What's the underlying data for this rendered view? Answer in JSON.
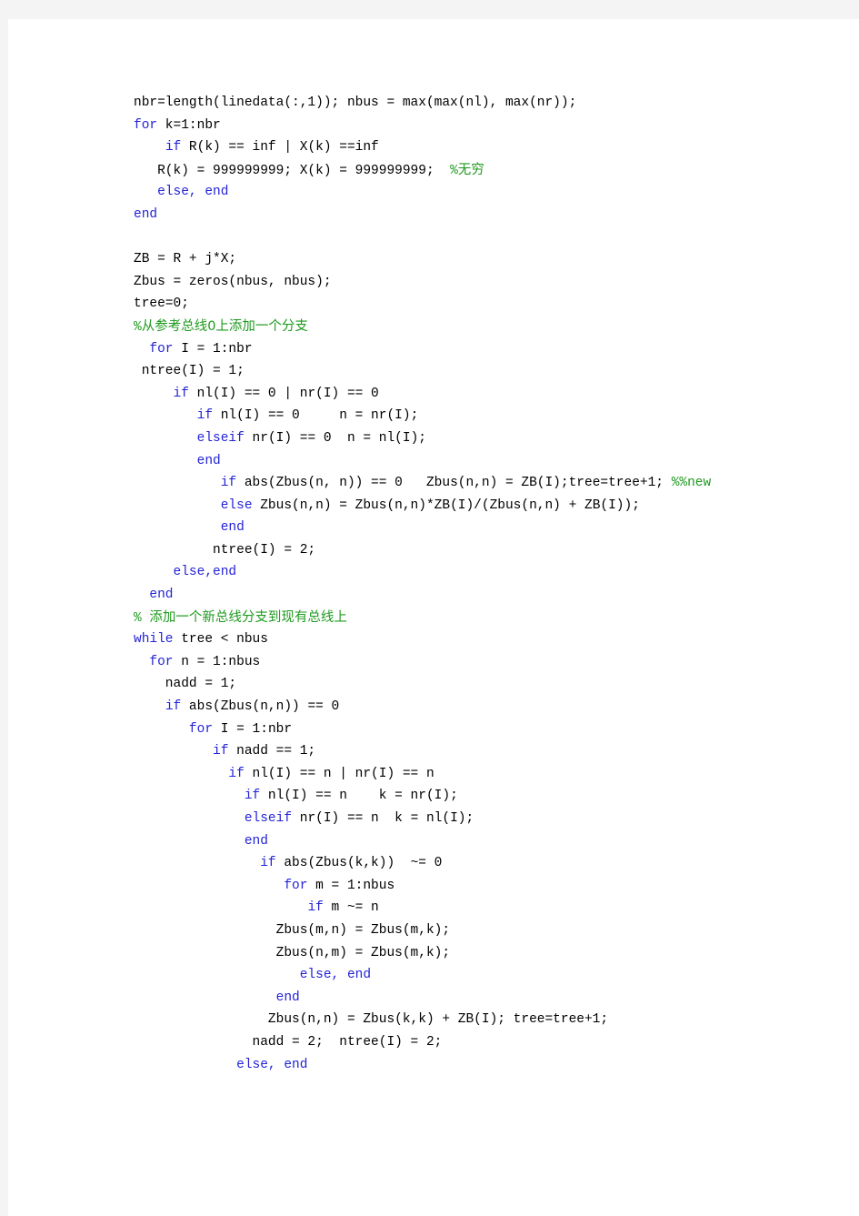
{
  "document": {
    "type": "code-listing",
    "language": "MATLAB",
    "page_background": "#ffffff",
    "canvas_background": "#f4f4f4",
    "colors": {
      "keyword": "#2323d8",
      "comment": "#1f9a1f",
      "plain": "#000000"
    }
  },
  "code": {
    "lines": [
      {
        "id": "line-1",
        "tokens": [
          {
            "t": "plain",
            "s": "nbr=length(linedata(:,1)); nbus = max(max(nl), max(nr));"
          }
        ]
      },
      {
        "id": "line-2",
        "tokens": [
          {
            "t": "kw",
            "s": "for"
          },
          {
            "t": "plain",
            "s": " k=1:nbr"
          }
        ]
      },
      {
        "id": "line-3",
        "tokens": [
          {
            "t": "plain",
            "s": "    "
          },
          {
            "t": "kw",
            "s": "if"
          },
          {
            "t": "plain",
            "s": " R(k) == inf | X(k) ==inf"
          }
        ]
      },
      {
        "id": "line-4",
        "tokens": [
          {
            "t": "plain",
            "s": "   R(k) = 999999999; X(k) = 999999999;  "
          },
          {
            "t": "cm",
            "s": "%"
          },
          {
            "t": "cjk",
            "s": "无穷"
          }
        ]
      },
      {
        "id": "line-5",
        "tokens": [
          {
            "t": "plain",
            "s": "   "
          },
          {
            "t": "kw",
            "s": "else, end"
          }
        ]
      },
      {
        "id": "line-6",
        "tokens": [
          {
            "t": "kw",
            "s": "end"
          }
        ]
      },
      {
        "id": "line-7",
        "blank": true,
        "tokens": []
      },
      {
        "id": "line-8",
        "tokens": [
          {
            "t": "plain",
            "s": "ZB = R + j*X;"
          }
        ]
      },
      {
        "id": "line-9",
        "tokens": [
          {
            "t": "plain",
            "s": "Zbus = zeros(nbus, nbus);"
          }
        ]
      },
      {
        "id": "line-10",
        "tokens": [
          {
            "t": "plain",
            "s": "tree=0;"
          }
        ]
      },
      {
        "id": "line-11",
        "tokens": [
          {
            "t": "cm",
            "s": "%"
          },
          {
            "t": "cjk",
            "s": "从参考总线0上添加一个分支"
          }
        ]
      },
      {
        "id": "line-12",
        "tokens": [
          {
            "t": "plain",
            "s": "  "
          },
          {
            "t": "kw",
            "s": "for"
          },
          {
            "t": "plain",
            "s": " I = 1:nbr"
          }
        ]
      },
      {
        "id": "line-13",
        "tokens": [
          {
            "t": "plain",
            "s": " ntree(I) = 1;"
          }
        ]
      },
      {
        "id": "line-14",
        "tokens": [
          {
            "t": "plain",
            "s": "     "
          },
          {
            "t": "kw",
            "s": "if"
          },
          {
            "t": "plain",
            "s": " nl(I) == 0 | nr(I) == 0"
          }
        ]
      },
      {
        "id": "line-15",
        "tokens": [
          {
            "t": "plain",
            "s": "        "
          },
          {
            "t": "kw",
            "s": "if"
          },
          {
            "t": "plain",
            "s": " nl(I) == 0     n = nr(I);"
          }
        ]
      },
      {
        "id": "line-16",
        "tokens": [
          {
            "t": "plain",
            "s": "        "
          },
          {
            "t": "kw",
            "s": "elseif"
          },
          {
            "t": "plain",
            "s": " nr(I) == 0  n = nl(I);"
          }
        ]
      },
      {
        "id": "line-17",
        "tokens": [
          {
            "t": "plain",
            "s": "        "
          },
          {
            "t": "kw",
            "s": "end"
          }
        ]
      },
      {
        "id": "line-18",
        "tokens": [
          {
            "t": "plain",
            "s": "           "
          },
          {
            "t": "kw",
            "s": "if"
          },
          {
            "t": "plain",
            "s": " abs(Zbus(n, n)) == 0   Zbus(n,n) = ZB(I);tree=tree+1; "
          },
          {
            "t": "cm",
            "s": "%%new"
          }
        ]
      },
      {
        "id": "line-19",
        "tokens": [
          {
            "t": "plain",
            "s": "           "
          },
          {
            "t": "kw",
            "s": "else"
          },
          {
            "t": "plain",
            "s": " Zbus(n,n) = Zbus(n,n)*ZB(I)/(Zbus(n,n) + ZB(I));"
          }
        ]
      },
      {
        "id": "line-20",
        "tokens": [
          {
            "t": "plain",
            "s": "           "
          },
          {
            "t": "kw",
            "s": "end"
          }
        ]
      },
      {
        "id": "line-21",
        "tokens": [
          {
            "t": "plain",
            "s": "          ntree(I) = 2;"
          }
        ]
      },
      {
        "id": "line-22",
        "tokens": [
          {
            "t": "plain",
            "s": "     "
          },
          {
            "t": "kw",
            "s": "else,end"
          }
        ]
      },
      {
        "id": "line-23",
        "tokens": [
          {
            "t": "plain",
            "s": "  "
          },
          {
            "t": "kw",
            "s": "end"
          }
        ]
      },
      {
        "id": "line-24",
        "tokens": [
          {
            "t": "cm",
            "s": "% "
          },
          {
            "t": "cjk",
            "s": "添加一个新总线分支到现有总线上"
          }
        ]
      },
      {
        "id": "line-25",
        "tokens": [
          {
            "t": "kw",
            "s": "while"
          },
          {
            "t": "plain",
            "s": " tree < nbus"
          }
        ]
      },
      {
        "id": "line-26",
        "tokens": [
          {
            "t": "plain",
            "s": "  "
          },
          {
            "t": "kw",
            "s": "for"
          },
          {
            "t": "plain",
            "s": " n = 1:nbus"
          }
        ]
      },
      {
        "id": "line-27",
        "tokens": [
          {
            "t": "plain",
            "s": "    nadd = 1;"
          }
        ]
      },
      {
        "id": "line-28",
        "tokens": [
          {
            "t": "plain",
            "s": "    "
          },
          {
            "t": "kw",
            "s": "if"
          },
          {
            "t": "plain",
            "s": " abs(Zbus(n,n)) == 0"
          }
        ]
      },
      {
        "id": "line-29",
        "tokens": [
          {
            "t": "plain",
            "s": "       "
          },
          {
            "t": "kw",
            "s": "for"
          },
          {
            "t": "plain",
            "s": " I = 1:nbr"
          }
        ]
      },
      {
        "id": "line-30",
        "tokens": [
          {
            "t": "plain",
            "s": "          "
          },
          {
            "t": "kw",
            "s": "if"
          },
          {
            "t": "plain",
            "s": " nadd == 1;"
          }
        ]
      },
      {
        "id": "line-31",
        "tokens": [
          {
            "t": "plain",
            "s": "            "
          },
          {
            "t": "kw",
            "s": "if"
          },
          {
            "t": "plain",
            "s": " nl(I) == n | nr(I) == n"
          }
        ]
      },
      {
        "id": "line-32",
        "tokens": [
          {
            "t": "plain",
            "s": "              "
          },
          {
            "t": "kw",
            "s": "if"
          },
          {
            "t": "plain",
            "s": " nl(I) == n    k = nr(I);"
          }
        ]
      },
      {
        "id": "line-33",
        "tokens": [
          {
            "t": "plain",
            "s": "              "
          },
          {
            "t": "kw",
            "s": "elseif"
          },
          {
            "t": "plain",
            "s": " nr(I) == n  k = nl(I);"
          }
        ]
      },
      {
        "id": "line-34",
        "tokens": [
          {
            "t": "plain",
            "s": "              "
          },
          {
            "t": "kw",
            "s": "end"
          }
        ]
      },
      {
        "id": "line-35",
        "tokens": [
          {
            "t": "plain",
            "s": "                "
          },
          {
            "t": "kw",
            "s": "if"
          },
          {
            "t": "plain",
            "s": " abs(Zbus(k,k))  ~= 0"
          }
        ]
      },
      {
        "id": "line-36",
        "tokens": [
          {
            "t": "plain",
            "s": "                   "
          },
          {
            "t": "kw",
            "s": "for"
          },
          {
            "t": "plain",
            "s": " m = 1:nbus"
          }
        ]
      },
      {
        "id": "line-37",
        "tokens": [
          {
            "t": "plain",
            "s": "                      "
          },
          {
            "t": "kw",
            "s": "if"
          },
          {
            "t": "plain",
            "s": " m ~= n"
          }
        ]
      },
      {
        "id": "line-38",
        "tokens": [
          {
            "t": "plain",
            "s": "                  Zbus(m,n) = Zbus(m,k);"
          }
        ]
      },
      {
        "id": "line-39",
        "tokens": [
          {
            "t": "plain",
            "s": "                  Zbus(n,m) = Zbus(m,k);"
          }
        ]
      },
      {
        "id": "line-40",
        "tokens": [
          {
            "t": "plain",
            "s": "                     "
          },
          {
            "t": "kw",
            "s": "else, end"
          }
        ]
      },
      {
        "id": "line-41",
        "tokens": [
          {
            "t": "plain",
            "s": "                  "
          },
          {
            "t": "kw",
            "s": "end"
          }
        ]
      },
      {
        "id": "line-42",
        "tokens": [
          {
            "t": "plain",
            "s": "                 Zbus(n,n) = Zbus(k,k) + ZB(I); tree=tree+1;"
          }
        ]
      },
      {
        "id": "line-43",
        "tokens": [
          {
            "t": "plain",
            "s": "               nadd = 2;  ntree(I) = 2;"
          }
        ]
      },
      {
        "id": "line-44",
        "tokens": [
          {
            "t": "plain",
            "s": "             "
          },
          {
            "t": "kw",
            "s": "else, end"
          }
        ]
      }
    ]
  }
}
